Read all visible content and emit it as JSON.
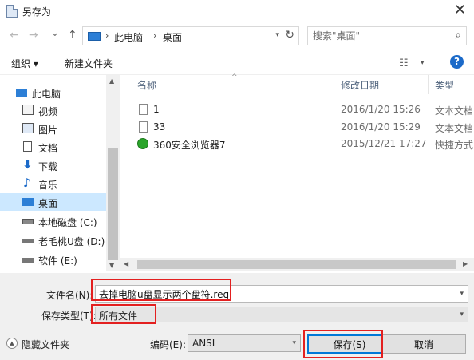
{
  "window": {
    "title": "另存为",
    "close": "✕"
  },
  "nav": {
    "back": "←",
    "forward": "→",
    "recent": "⌄",
    "up": "↑"
  },
  "address": {
    "crumbs": [
      "此电脑",
      "桌面"
    ],
    "separator": "›",
    "dropdown": "▾",
    "refresh": "↻"
  },
  "search": {
    "placeholder": "搜索\"桌面\"",
    "icon": "search-icon"
  },
  "toolbar": {
    "organize": "组织 ▾",
    "new_folder": "新建文件夹",
    "view_glyph": "☷",
    "view_dd": "▾",
    "help": "?"
  },
  "sidebar": {
    "items": [
      {
        "label": "此电脑",
        "icon": "computer-icon",
        "color": "#2d7fd6"
      },
      {
        "label": "视频",
        "icon": "video-icon",
        "color": "#555555"
      },
      {
        "label": "图片",
        "icon": "pictures-icon",
        "color": "#555555"
      },
      {
        "label": "文档",
        "icon": "documents-icon",
        "color": "#555555"
      },
      {
        "label": "下载",
        "icon": "download-icon",
        "color": "#1b6ac9"
      },
      {
        "label": "音乐",
        "icon": "music-icon",
        "color": "#1b6ac9"
      },
      {
        "label": "桌面",
        "icon": "desktop-icon",
        "color": "#2d7fd6",
        "selected": true
      },
      {
        "label": "本地磁盘 (C:)",
        "icon": "drive-icon",
        "color": "#666666"
      },
      {
        "label": "老毛桃U盘 (D:)",
        "icon": "usb-drive-icon",
        "color": "#666666"
      },
      {
        "label": "软件 (E:)",
        "icon": "drive-icon",
        "color": "#666666"
      }
    ]
  },
  "columns": {
    "name": "名称",
    "date": "修改日期",
    "type": "类型",
    "sort": "^"
  },
  "files": [
    {
      "name": "1",
      "date": "2016/1/20 15:26",
      "type": "文本文档",
      "icon": "text-file-icon"
    },
    {
      "name": "33",
      "date": "2016/1/20 15:29",
      "type": "文本文档",
      "icon": "text-file-icon"
    },
    {
      "name": "360安全浏览器7",
      "date": "2015/12/21 17:27",
      "type": "快捷方式",
      "icon": "browser-shortcut-icon"
    }
  ],
  "form": {
    "filename_label": "文件名(N):",
    "filename_value": "去掉电脑u盘显示两个盘符.reg",
    "filetype_label": "保存类型(T):",
    "filetype_value": "所有文件",
    "dropdown": "▾"
  },
  "bottom": {
    "hide_folders": "隐藏文件夹",
    "hide_glyph": "▲",
    "encoding_label": "编码(E):",
    "encoding_value": "ANSI",
    "save": "保存(S)",
    "cancel": "取消"
  },
  "scroll": {
    "up": "▲",
    "down": "▼",
    "left": "◀",
    "right": "▶"
  },
  "colors": {
    "selected_bg": "#cce8ff",
    "highlight": "#e32020",
    "help": "#1b6ac9",
    "primary_border": "#0078d7"
  }
}
